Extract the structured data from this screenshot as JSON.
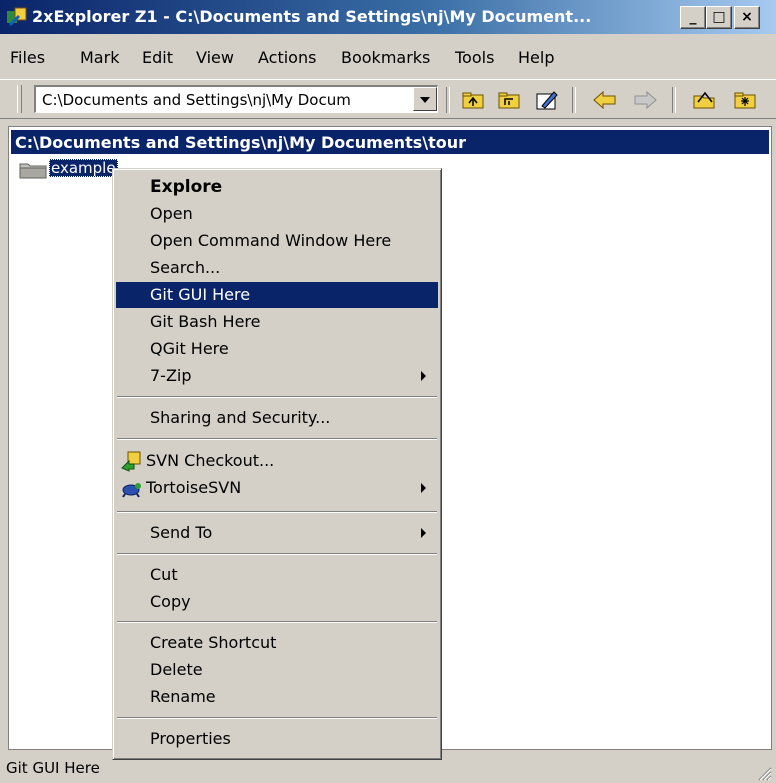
{
  "window": {
    "title": "2xExplorer Z1 - C:\\Documents and Settings\\nj\\My Document...",
    "minimize": "_",
    "maximize": "□",
    "close": "×"
  },
  "menubar": [
    "Files",
    "Mark",
    "Edit",
    "View",
    "Actions",
    "Bookmarks",
    "Tools",
    "Help"
  ],
  "toolbar": {
    "address": "C:\\Documents and Settings\\nj\\My Docum",
    "icons": [
      "up-folder-icon",
      "root-folder-icon",
      "edit-folder-icon",
      "back-arrow-icon",
      "forward-arrow-icon",
      "open-folder-icon",
      "new-folder-icon"
    ]
  },
  "panel": {
    "path": "C:\\Documents and Settings\\nj\\My Documents\\tour",
    "items": [
      {
        "name": "example",
        "icon": "folder-icon",
        "selected": true
      }
    ]
  },
  "context_menu": {
    "groups": [
      [
        {
          "label": "Explore",
          "bold": true
        },
        {
          "label": "Open"
        },
        {
          "label": "Open Command Window Here"
        },
        {
          "label": "Search..."
        },
        {
          "label": "Git GUI Here",
          "highlighted": true
        },
        {
          "label": "Git Bash Here"
        },
        {
          "label": "QGit Here"
        },
        {
          "label": "7-Zip",
          "submenu": true
        }
      ],
      [
        {
          "label": "Sharing and Security..."
        }
      ],
      [
        {
          "label": "SVN Checkout...",
          "icon": "svn-checkout-icon"
        },
        {
          "label": "TortoiseSVN",
          "icon": "tortoisesvn-icon",
          "submenu": true
        }
      ],
      [
        {
          "label": "Send To",
          "submenu": true
        }
      ],
      [
        {
          "label": "Cut"
        },
        {
          "label": "Copy"
        }
      ],
      [
        {
          "label": "Create Shortcut"
        },
        {
          "label": "Delete"
        },
        {
          "label": "Rename"
        }
      ],
      [
        {
          "label": "Properties"
        }
      ]
    ]
  },
  "status": {
    "text": "Git GUI Here"
  },
  "colors": {
    "highlight": "#0a246a",
    "face": "#d4d0c8",
    "title_start": "#0a246a",
    "title_end": "#a6caf0"
  }
}
